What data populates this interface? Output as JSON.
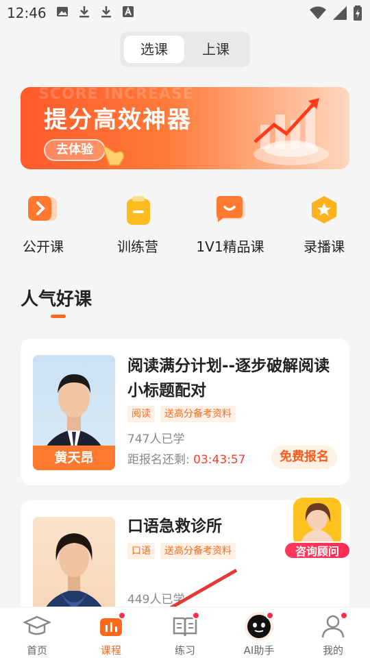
{
  "status_bar": {
    "time": "12:46"
  },
  "segment": {
    "tabs": [
      "选课",
      "上课"
    ],
    "active": "选课"
  },
  "banner": {
    "watermark": "SCORE INCREASE",
    "title": "提分高效神器",
    "button": "去体验"
  },
  "categories": [
    {
      "label": "公开课",
      "icon": "play-card-icon"
    },
    {
      "label": "训练营",
      "icon": "clipboard-icon"
    },
    {
      "label": "1V1精品课",
      "icon": "chat-smile-icon"
    },
    {
      "label": "录播课",
      "icon": "star-badge-icon"
    }
  ],
  "section": {
    "title": "人气好课"
  },
  "courses": [
    {
      "teacher": "黄天昂",
      "title": "阅读满分计划--逐步破解阅读小标题配对",
      "tags": [
        "阅读",
        "送高分备考资料"
      ],
      "enrolled": "747人已学",
      "countdown_label": "距报名还剩:",
      "countdown_time": "03:43:57",
      "button": "免费报名"
    },
    {
      "title": "口语急救诊所",
      "tags": [
        "口语",
        "送高分备考资料"
      ],
      "enrolled": "449人已学"
    }
  ],
  "consult": {
    "label": "咨询顾问"
  },
  "tabbar": [
    {
      "label": "首页",
      "icon": "graduation-cap-icon",
      "active": false,
      "dot": false
    },
    {
      "label": "课程",
      "icon": "bar-chart-icon",
      "active": true,
      "dot": true
    },
    {
      "label": "练习",
      "icon": "book-icon",
      "active": false,
      "dot": true
    },
    {
      "label": "AI助手",
      "icon": "ai-bot-icon",
      "active": false,
      "dot": true
    },
    {
      "label": "我的",
      "icon": "person-icon",
      "active": false,
      "dot": true
    }
  ],
  "colors": {
    "accent": "#ff6a1a",
    "red": "#ff3b2f"
  }
}
